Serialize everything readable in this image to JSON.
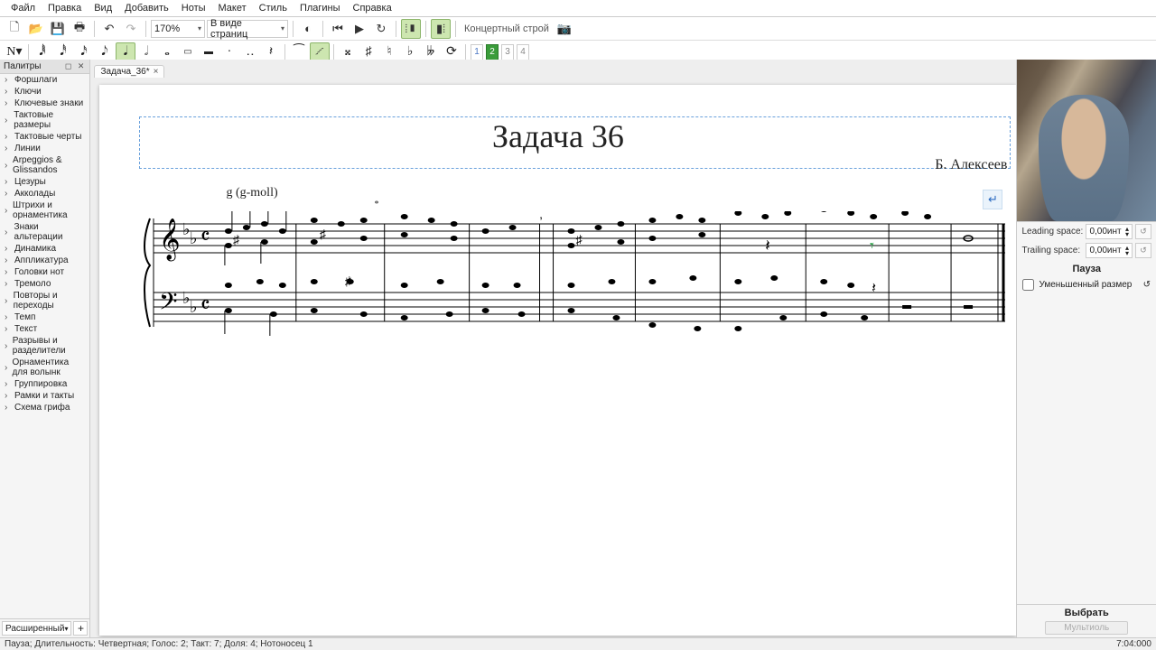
{
  "menu": {
    "file": "Файл",
    "edit": "Правка",
    "view": "Вид",
    "add": "Добавить",
    "notes": "Ноты",
    "layout": "Макет",
    "style": "Стиль",
    "plugins": "Плагины",
    "help": "Справка"
  },
  "toolbar1": {
    "zoom": "170%",
    "viewmode": "В виде страниц",
    "concert": "Концертный строй"
  },
  "notebar": {
    "voices": [
      "1",
      "2",
      "3",
      "4"
    ],
    "active_voice": 2
  },
  "palettes": {
    "title": "Палитры",
    "items": [
      "Форшлаги",
      "Ключи",
      "Ключевые знаки",
      "Тактовые размеры",
      "Тактовые черты",
      "Линии",
      "Arpeggios & Glissandos",
      "Цезуры",
      "Акколады",
      "Штрихи и орнаментика",
      "Знаки альтерации",
      "Динамика",
      "Аппликатура",
      "Головки нот",
      "Тремоло",
      "Повторы и переходы",
      "Темп",
      "Текст",
      "Разрывы и разделители",
      "Орнаментика для волынк",
      "Группировка",
      "Рамки и такты",
      "Схема грифа"
    ],
    "footer_mode": "Расширенный"
  },
  "tab": {
    "name": "Задача_36*",
    "close": "×"
  },
  "score": {
    "title": "Задача 36",
    "composer": "Б. Алексеев",
    "key_annotation": "g (g-moll)",
    "star": "*"
  },
  "props": {
    "leading_label": "Leading space:",
    "leading_value": "0,00инт",
    "trailing_label": "Trailing space:",
    "trailing_value": "0,00инт",
    "section": "Пауза",
    "smallsize": "Уменьшенный размер",
    "select": "Выбрать",
    "multi": "Мультиоль"
  },
  "status": {
    "left": "Пауза; Длительность: Четвертная; Голос: 2; Такт: 7; Доля: 4; Нотоносец 1",
    "right": "7:04:000"
  }
}
